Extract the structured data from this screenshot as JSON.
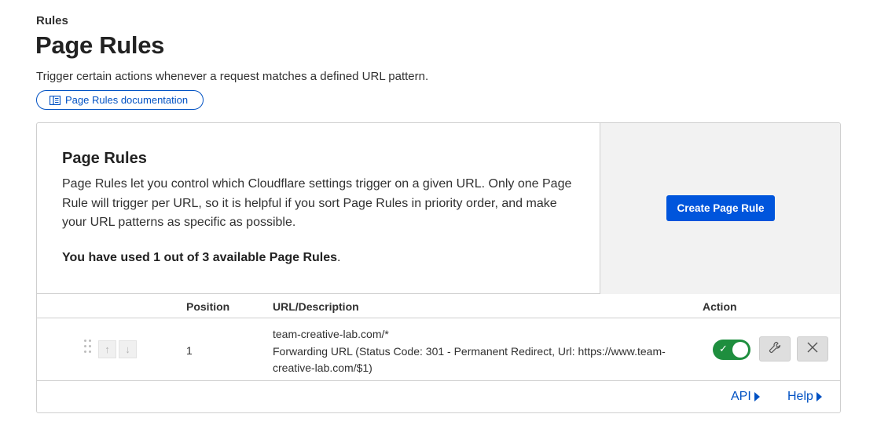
{
  "header": {
    "breadcrumb": "Rules",
    "title": "Page Rules",
    "subtitle": "Trigger certain actions whenever a request matches a defined URL pattern.",
    "doc_link": "Page Rules documentation"
  },
  "card": {
    "title": "Page Rules",
    "description": "Page Rules let you control which Cloudflare settings trigger on a given URL. Only one Page Rule will trigger per URL, so it is helpful if you sort Page Rules in priority order, and make your URL patterns as specific as possible.",
    "usage_bold": "You have used 1 out of 3 available Page Rules",
    "usage_end": ".",
    "create_button": "Create Page Rule"
  },
  "table": {
    "columns": {
      "position": "Position",
      "url": "URL/Description",
      "action": "Action"
    },
    "rows": [
      {
        "position": "1",
        "url": "team-creative-lab.com/*",
        "description": "Forwarding URL (Status Code: 301 - Permanent Redirect, Url: https://www.team-creative-lab.com/$1)",
        "enabled": true
      }
    ]
  },
  "footer": {
    "api": "API",
    "help": "Help"
  },
  "colors": {
    "accent": "#0051c3",
    "primary_button": "#0055dc",
    "toggle_on": "#1e8e3e"
  },
  "icons": [
    "book-icon",
    "drag-handle-icon",
    "arrow-up-icon",
    "arrow-down-icon",
    "check-icon",
    "wrench-icon",
    "close-icon",
    "triangle-right-icon"
  ]
}
